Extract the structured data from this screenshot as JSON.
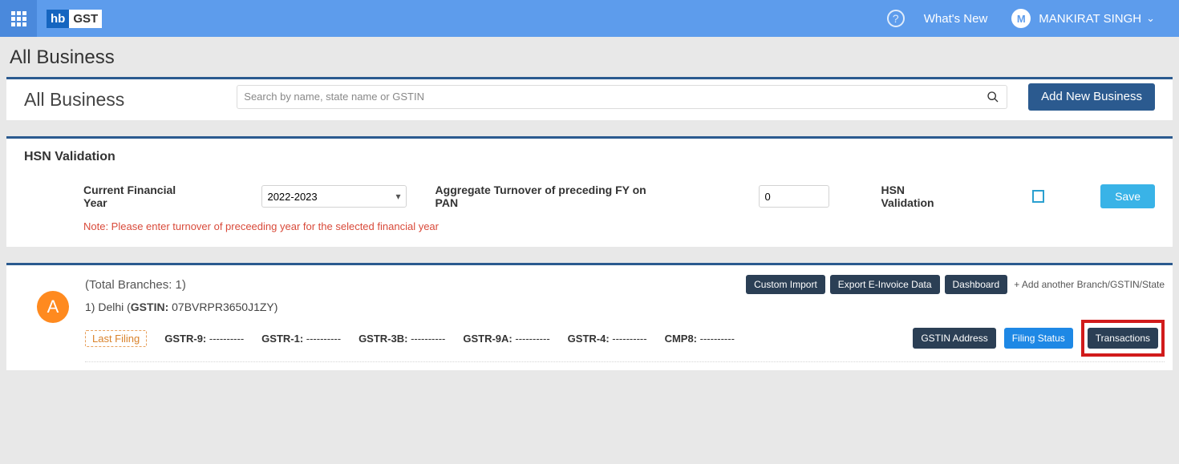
{
  "header": {
    "logo_left": "hb",
    "logo_right": "GST",
    "whats_new": "What's New",
    "user_initial": "M",
    "user_name": "MANKIRAT SINGH"
  },
  "page": {
    "title": "All Business"
  },
  "allBusiness": {
    "title": "All Business",
    "search_placeholder": "Search by name, state name or GSTIN",
    "add_button": "Add New Business"
  },
  "hsn": {
    "title": "HSN Validation",
    "year_label": "Current Financial Year",
    "year_value": "2022-2023",
    "turnover_label": "Aggregate Turnover of preceding FY on PAN",
    "turnover_value": "0",
    "validation_label": "HSN Validation",
    "save_label": "Save",
    "note": "Note: Please enter turnover of preceeding year for the selected financial year"
  },
  "business": {
    "avatar_letter": "A",
    "total_branches": "(Total Branches: 1)",
    "chips": {
      "custom_import": "Custom Import",
      "export_einvoice": "Export E-Invoice Data",
      "dashboard": "Dashboard"
    },
    "add_another": "+ Add another Branch/GSTIN/State",
    "branch_prefix": "1) Delhi (",
    "gstin_label": "GSTIN:",
    "gstin_value": " 07BVRPR3650J1ZY)",
    "last_filing": "Last Filing",
    "filings": [
      {
        "label": "GSTR-9:",
        "value": " ----------"
      },
      {
        "label": "GSTR-1:",
        "value": " ----------"
      },
      {
        "label": "GSTR-3B:",
        "value": " ----------"
      },
      {
        "label": "GSTR-9A:",
        "value": " ----------"
      },
      {
        "label": "GSTR-4:",
        "value": " ----------"
      },
      {
        "label": "CMP8:",
        "value": " ----------"
      }
    ],
    "buttons": {
      "gstin_address": "GSTIN Address",
      "filing_status": "Filing Status",
      "transactions": "Transactions"
    }
  }
}
